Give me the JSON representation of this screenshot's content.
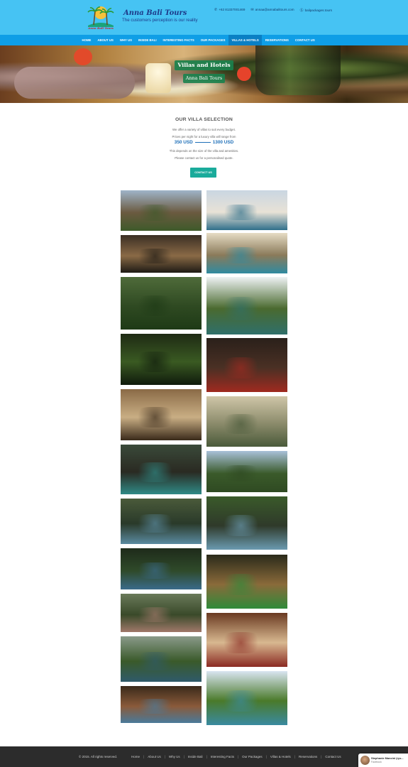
{
  "header": {
    "logo_text": "Anna Bali Tours",
    "brand_name": "Anna Bali Tours",
    "tagline": "The customers perception is our reality",
    "phone": "+62 81337001469",
    "email": "annaa@annabalitours.com",
    "site": "balipackages.tours",
    "phone_icon": "phone-icon",
    "email_icon": "envelope-icon",
    "site_icon": "skype-icon"
  },
  "nav": {
    "items": [
      "HOME",
      "ABOUT US",
      "WHY US",
      "INSIDE BALI",
      "INTERESTING FACTS",
      "OUR PACKAGES",
      "VILLAS & HOTELS",
      "RESERVATIONS",
      "CONTACT US"
    ],
    "active_index": 6
  },
  "hero": {
    "title": "Villas and Hotels",
    "subtitle": "Anna Bali Tours"
  },
  "intro": {
    "heading": "OUR VILLA SELECTION",
    "line1": "We offer a variety of villas to suit every budget.",
    "line2": "Prices per night for a luxury villa will range from",
    "price_low": "350 USD",
    "price_high": "1300 USD",
    "line3": "This depends on the size of the villa and amenities.",
    "line4": "Please contact us for a personalised quote.",
    "button": "CONTACT US"
  },
  "footer": {
    "copyright": "© 2015. All rights reserved.",
    "links": [
      "Home",
      "About Us",
      "Why Us",
      "Inside Bali",
      "Interesting Facts",
      "Our Packages",
      "Villas & Hotels",
      "Reservations",
      "Contact Us"
    ]
  },
  "facebook_widget": {
    "name": "Stephanie Mancini (rys...",
    "source": "Facebook"
  },
  "colors": {
    "topbar": "#46c3f3",
    "nav": "#0f9ee6",
    "hero_label": "#1a824e",
    "price": "#1e6fb8",
    "button": "#1aab9b",
    "footer": "#2c2c2c"
  }
}
